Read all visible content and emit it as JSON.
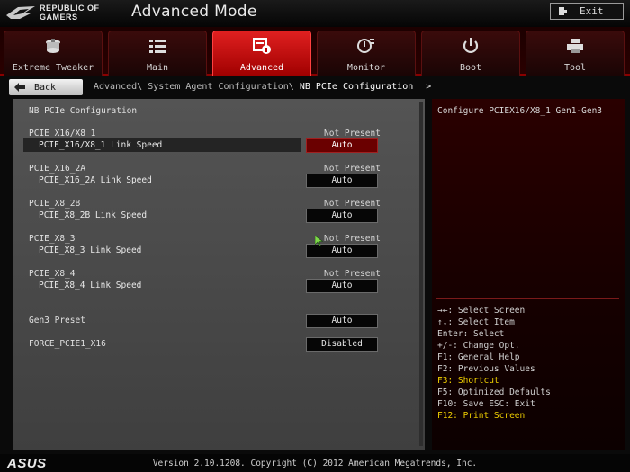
{
  "brand": {
    "line1": "REPUBLIC OF",
    "line2": "GAMERS"
  },
  "window": {
    "title": "Advanced Mode",
    "exit_label": "Exit"
  },
  "tabs": [
    {
      "label": "Extreme Tweaker",
      "icon": "fan-icon"
    },
    {
      "label": "Main",
      "icon": "list-icon"
    },
    {
      "label": "Advanced",
      "icon": "chip-info-icon",
      "active": true
    },
    {
      "label": "Monitor",
      "icon": "gauge-icon"
    },
    {
      "label": "Boot",
      "icon": "power-icon"
    },
    {
      "label": "Tool",
      "icon": "printer-icon"
    }
  ],
  "nav": {
    "back_label": "Back",
    "breadcrumb": [
      "Advanced\\",
      "System Agent Configuration\\",
      "NB PCIe Configuration"
    ],
    "breadcrumb_arrow": ">"
  },
  "main": {
    "section_title": "NB PCIe Configuration",
    "slots": [
      {
        "name": "PCIE_X16/X8_1",
        "status": "Not Present",
        "setting": "PCIE_X16/X8_1 Link Speed",
        "value": "Auto",
        "selected": true
      },
      {
        "name": "PCIE_X16_2A",
        "status": "Not Present",
        "setting": "PCIE_X16_2A Link Speed",
        "value": "Auto"
      },
      {
        "name": "PCIE_X8_2B",
        "status": "Not Present",
        "setting": "PCIE_X8_2B Link Speed",
        "value": "Auto"
      },
      {
        "name": "PCIE_X8_3",
        "status": "Not Present",
        "setting": "PCIE_X8_3 Link Speed",
        "value": "Auto"
      },
      {
        "name": "PCIE_X8_4",
        "status": "Not Present",
        "setting": "PCIE_X8_4 Link Speed",
        "value": "Auto"
      }
    ],
    "gen3": {
      "label": "Gen3 Preset",
      "value": "Auto"
    },
    "force": {
      "label": "FORCE_PCIE1_X16",
      "value": "Disabled"
    }
  },
  "side": {
    "description": "Configure PCIEX16/X8_1 Gen1-Gen3",
    "help": [
      {
        "text": "→←: Select Screen"
      },
      {
        "text": "↑↓: Select Item"
      },
      {
        "text": "Enter: Select"
      },
      {
        "text": "+/-: Change Opt."
      },
      {
        "text": "F1: General Help"
      },
      {
        "text": "F2: Previous Values"
      },
      {
        "text": "F3: Shortcut",
        "highlight": true
      },
      {
        "text": "F5: Optimized Defaults"
      },
      {
        "text": "F10: Save  ESC: Exit"
      },
      {
        "text": "F12: Print Screen",
        "highlight": true
      }
    ]
  },
  "footer": {
    "logo": "ASUS",
    "version": "Version 2.10.1208. Copyright (C) 2012 American Megatrends, Inc."
  },
  "colors": {
    "accent": "#c00000",
    "highlight": "#f0d000",
    "panel": "#4a4a4a"
  }
}
